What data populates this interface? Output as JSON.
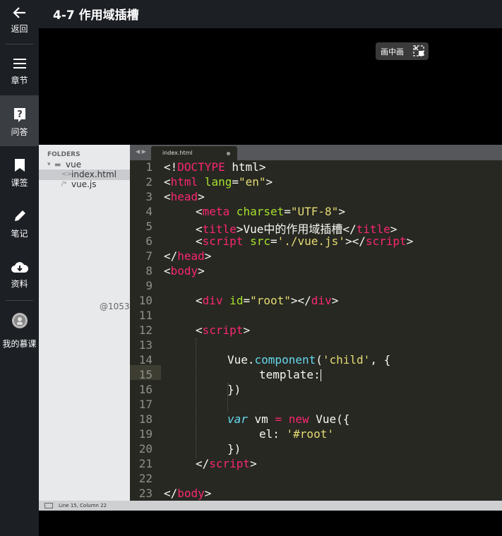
{
  "sidebar": {
    "items": [
      {
        "label": "返回",
        "icon": "back-arrow-icon"
      },
      {
        "label": "章节",
        "icon": "menu-icon"
      },
      {
        "label": "问答",
        "icon": "question-icon"
      },
      {
        "label": "课签",
        "icon": "bookmark-icon"
      },
      {
        "label": "笔记",
        "icon": "pencil-icon"
      },
      {
        "label": "资料",
        "icon": "cloud-download-icon"
      },
      {
        "label": "我的慕课",
        "icon": "avatar-icon"
      }
    ]
  },
  "header": {
    "title": "4-7 作用域插槽"
  },
  "player": {
    "pip_label": "画中画"
  },
  "editor": {
    "folders_title": "FOLDERS",
    "tree": [
      {
        "name": "vue",
        "type": "folder"
      },
      {
        "name": "index.html",
        "type": "file"
      },
      {
        "name": "vue.js",
        "type": "file"
      }
    ],
    "tab": "index.html",
    "status": "Line 15, Column 22",
    "watermark": "@1053",
    "line_numbers": [
      "1",
      "2",
      "3",
      "4",
      "5",
      "6",
      "7",
      "8",
      "9",
      "10",
      "11",
      "12",
      "13",
      "14",
      "15",
      "16",
      "17",
      "18",
      "19",
      "20",
      "21",
      "22",
      "23"
    ],
    "code": {
      "l1a": "<!",
      "l1b": "DOCTYPE",
      "l1c": " html>",
      "l2a": "<",
      "l2b": "html",
      "l2c": " lang",
      "l2d": "=",
      "l2e": "\"en\"",
      "l2f": ">",
      "l3a": "<",
      "l3b": "head",
      "l3c": ">",
      "l4a": "<",
      "l4b": "meta",
      "l4c": " charset",
      "l4d": "=",
      "l4e": "\"UTF-8\"",
      "l4f": ">",
      "l5a": "<",
      "l5b": "title",
      "l5c": ">Vue中的作用域插槽</",
      "l5d": "title",
      "l5e": ">",
      "l6a": "<",
      "l6b": "script",
      "l6c": " src",
      "l6d": "=",
      "l6e": "'./vue.js'",
      "l6f": "></",
      "l6g": "script",
      "l6h": ">",
      "l7a": "</",
      "l7b": "head",
      "l7c": ">",
      "l8a": "<",
      "l8b": "body",
      "l8c": ">",
      "l10a": "<",
      "l10b": "div",
      "l10c": " id",
      "l10d": "=",
      "l10e": "\"root\"",
      "l10f": "></",
      "l10g": "div",
      "l10h": ">",
      "l12a": "<",
      "l12b": "script",
      "l12c": ">",
      "l14a": "Vue.",
      "l14b": "component",
      "l14c": "(",
      "l14d": "'child'",
      "l14e": ", {",
      "l15a": "template:",
      "l16a": "})",
      "l18a": "var",
      "l18b": " vm ",
      "l18c": "=",
      "l18d": " ",
      "l18e": "new",
      "l18f": " Vue({",
      "l19a": "el: ",
      "l19b": "'#root'",
      "l20a": "})",
      "l21a": "</",
      "l21b": "script",
      "l21c": ">",
      "l23a": "</",
      "l23b": "body",
      "l23c": ">"
    }
  },
  "colors": {
    "tag": "#f92672",
    "attr": "#a6e22e",
    "string": "#e6db74",
    "keyword": "#66d9ef",
    "editor_bg": "#272822"
  }
}
